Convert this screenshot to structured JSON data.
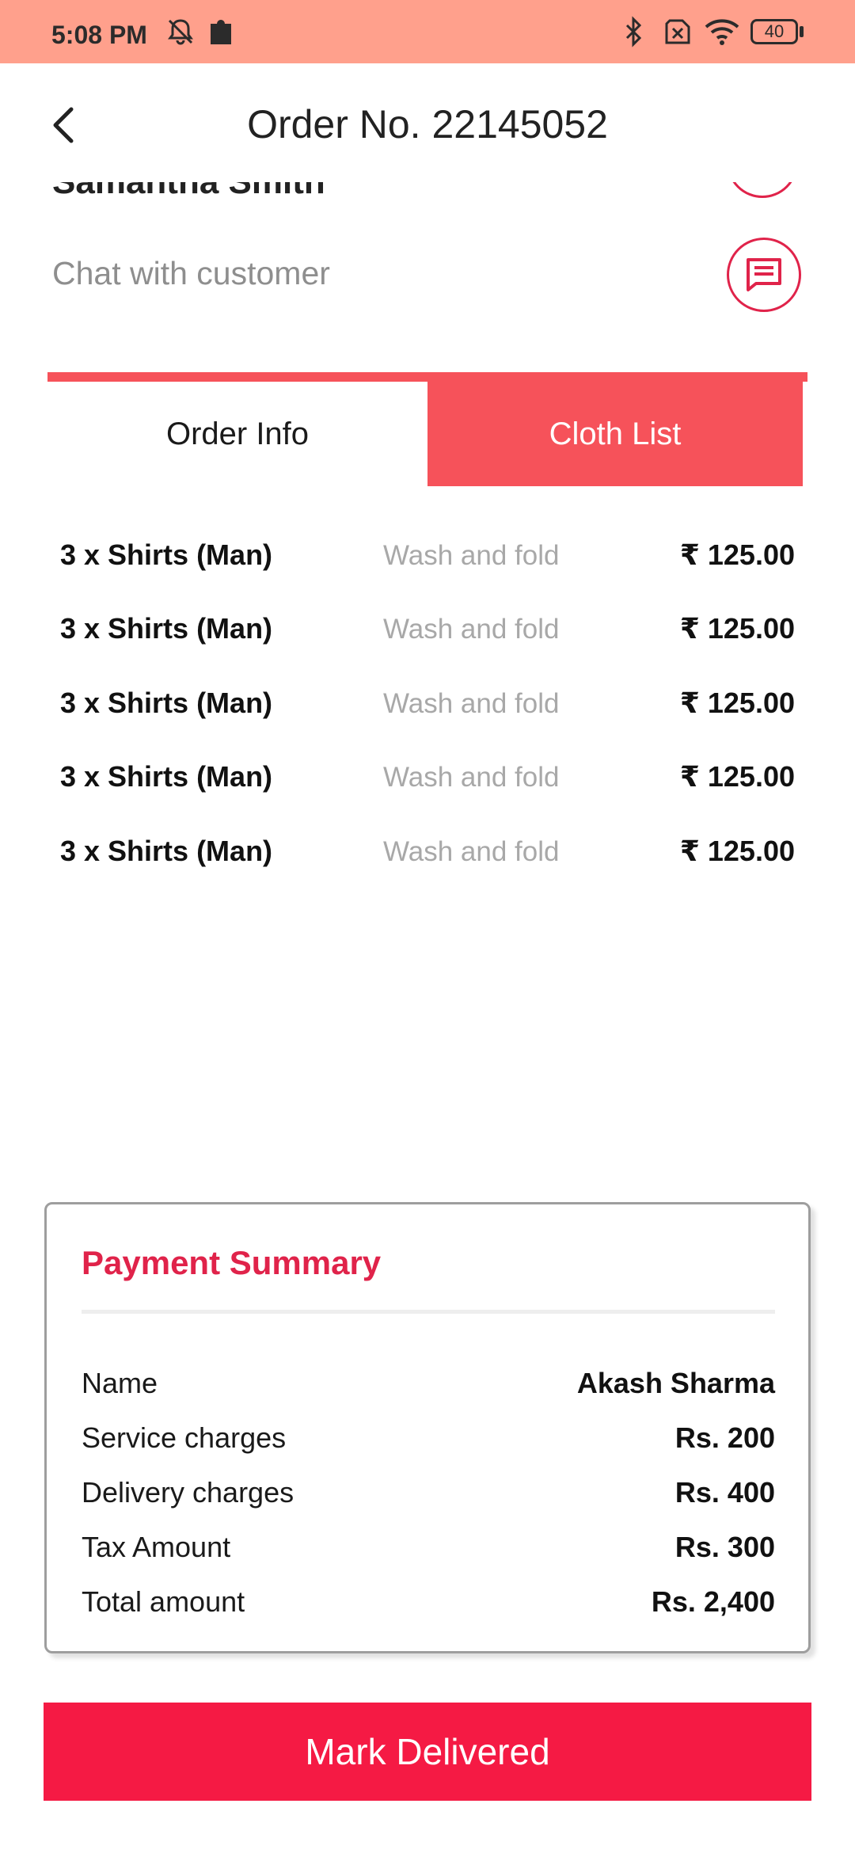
{
  "status_bar": {
    "time": "5:08 PM",
    "battery": "40"
  },
  "header": {
    "title": "Order No. 22145052"
  },
  "customer": {
    "name": "Samantha Smith",
    "chat_label": "Chat with customer"
  },
  "tabs": [
    {
      "label": "Order Info",
      "active": false
    },
    {
      "label": "Cloth List",
      "active": true
    }
  ],
  "cloth_list": [
    {
      "item": "3 x Shirts (Man)",
      "service": "Wash and fold",
      "price": "₹ 125.00"
    },
    {
      "item": "3 x Shirts (Man)",
      "service": "Wash and fold",
      "price": "₹ 125.00"
    },
    {
      "item": "3 x Shirts (Man)",
      "service": "Wash and fold",
      "price": "₹ 125.00"
    },
    {
      "item": "3 x Shirts (Man)",
      "service": "Wash and fold",
      "price": "₹ 125.00"
    },
    {
      "item": "3 x Shirts (Man)",
      "service": "Wash and fold",
      "price": "₹ 125.00"
    }
  ],
  "payment_summary": {
    "title": "Payment Summary",
    "rows": [
      {
        "label": "Name",
        "value": "Akash Sharma"
      },
      {
        "label": "Service charges",
        "value": "Rs. 200"
      },
      {
        "label": "Delivery charges",
        "value": "Rs. 400"
      },
      {
        "label": "Tax Amount",
        "value": "Rs. 300"
      },
      {
        "label": "Total amount",
        "value": "Rs. 2,400"
      }
    ]
  },
  "actions": {
    "mark_delivered": "Mark Delivered"
  },
  "colors": {
    "status_bar": "#FFA08C",
    "tab_active": "#F6525A",
    "accent": "#E0234A",
    "button": "#F51A44"
  },
  "icons": [
    "back-arrow-icon",
    "chat-icon",
    "bell-off-icon",
    "puzzle-icon",
    "bluetooth-icon",
    "sim-off-icon",
    "wifi-icon",
    "battery-icon"
  ]
}
